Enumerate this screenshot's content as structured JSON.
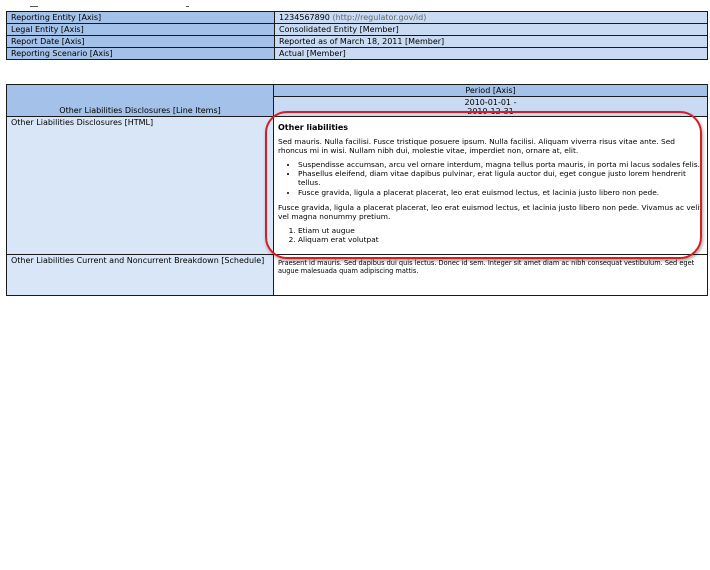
{
  "context": [
    {
      "label": "Reporting Entity [Axis]",
      "value": "1234567890",
      "value_suffix": " (http://regulator.gov/id)"
    },
    {
      "label": "Legal Entity [Axis]",
      "value": "Consolidated Entity [Member]",
      "value_suffix": ""
    },
    {
      "label": "Report Date [Axis]",
      "value": "Reported as of March 18, 2011 [Member]",
      "value_suffix": ""
    },
    {
      "label": "Reporting Scenario [Axis]",
      "value": "Actual [Member]",
      "value_suffix": ""
    }
  ],
  "main": {
    "period_header": "Period [Axis]",
    "line_items_header": "Other Liabilities Disclosures [Line Items]",
    "period_start": "2010-01-01 -",
    "period_end": "2010-12-31",
    "rows": {
      "html": {
        "label": "Other Liabilities Disclosures [HTML]",
        "heading": "Other liabilities",
        "para1": "Sed mauris. Nulla facilisi. Fusce tristique posuere ipsum. Nulla facilisi. Aliquam viverra risus vitae ante. Sed rhoncus mi in wisi. Nullam nibh dui, molestie vitae, imperdiet non, ornare at, elit.",
        "bullets": [
          "Suspendisse accumsan, arcu vel ornare interdum, magna tellus porta mauris, in porta mi lacus sodales felis.",
          "Phasellus eleifend, diam vitae dapibus pulvinar, erat ligula auctor dui, eget congue justo lorem hendrerit tellus.",
          "Fusce gravida, ligula a placerat placerat, leo erat euismod lectus, et lacinia justo libero non pede."
        ],
        "para2": "Fusce gravida, ligula a placerat placerat, leo erat euismod lectus, et lacinia justo libero non pede. Vivamus ac velit vel magna nonummy pretium.",
        "numbered": [
          "Etiam ut augue",
          "Aliquam erat volutpat"
        ]
      },
      "schedule": {
        "label": "Other Liabilities Current and Noncurrent Breakdown [Schedule]",
        "text": "Praesent id mauris. Sed dapibus dui quis lectus. Donec id sem. Integer sit amet diam ac nibh consequat vestibulum. Sed eget augue malesuada quam adipiscing mattis."
      }
    }
  }
}
